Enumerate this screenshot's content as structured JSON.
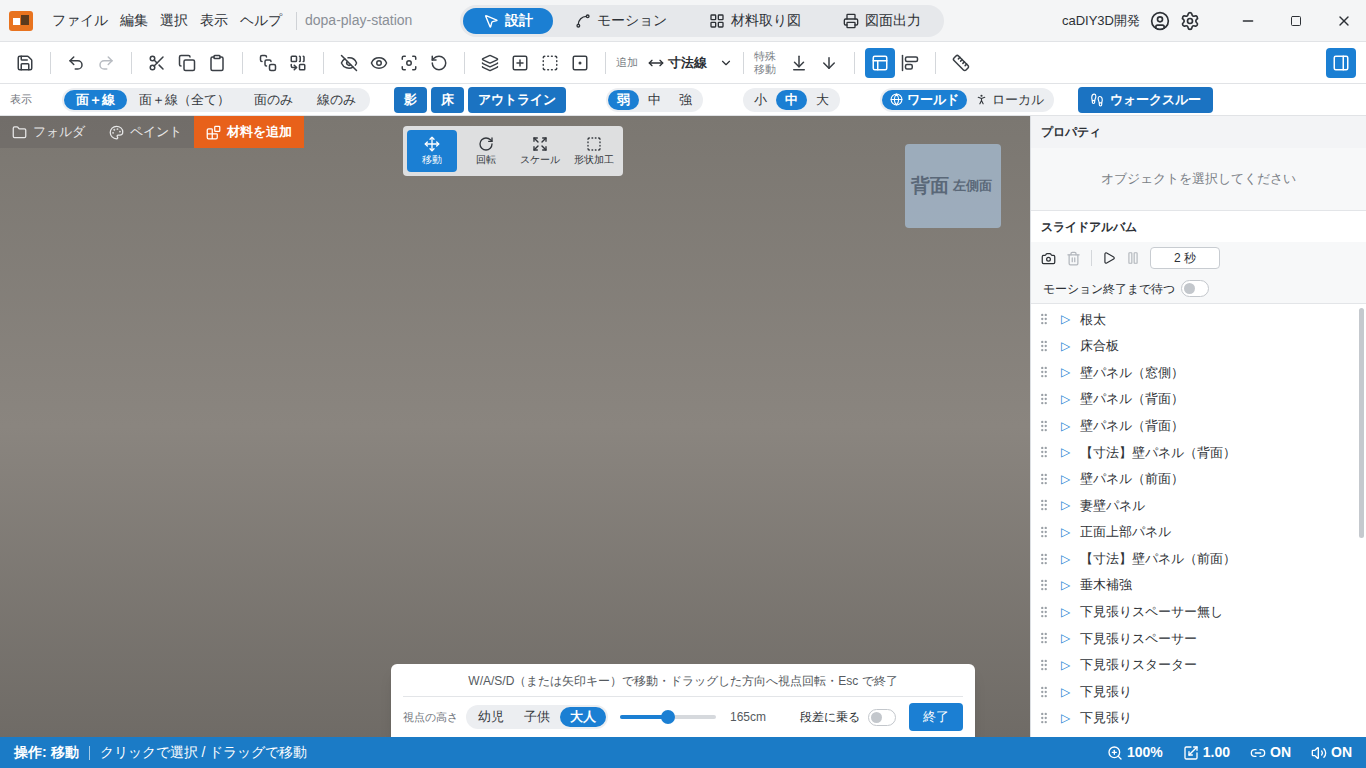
{
  "app": {
    "menu": [
      "ファイル",
      "編集",
      "選択",
      "表示",
      "ヘルプ"
    ],
    "project": "dopa-play-station",
    "modes": [
      {
        "label": "設計",
        "selected": true
      },
      {
        "label": "モーション",
        "selected": false
      },
      {
        "label": "材料取り図",
        "selected": false
      },
      {
        "label": "図面出力",
        "selected": false
      }
    ],
    "user": "caDIY3D開発"
  },
  "toolbar": {
    "redo_disabled": true,
    "add_label": "追加",
    "dimension": "寸法線",
    "special_move": [
      "特殊",
      "移動"
    ],
    "info_panel_on": true,
    "side_panel_on": true
  },
  "display_bar": {
    "label": "表示",
    "render_modes": [
      {
        "label": "面＋線",
        "selected": true
      },
      {
        "label": "面＋線（全て）",
        "selected": false
      },
      {
        "label": "面のみ",
        "selected": false
      },
      {
        "label": "線のみ",
        "selected": false
      }
    ],
    "toggles": [
      {
        "label": "影",
        "on": true
      },
      {
        "label": "床",
        "on": true
      },
      {
        "label": "アウトライン",
        "on": true
      }
    ],
    "strength": [
      {
        "label": "弱",
        "selected": true
      },
      {
        "label": "中",
        "selected": false
      },
      {
        "label": "強",
        "selected": false
      }
    ],
    "size": [
      {
        "label": "小",
        "selected": false
      },
      {
        "label": "中",
        "selected": true
      },
      {
        "label": "大",
        "selected": false
      }
    ],
    "space": [
      {
        "label": "ワールド",
        "selected": true
      },
      {
        "label": "ローカル",
        "selected": false
      }
    ],
    "walkthrough": "ウォークスルー"
  },
  "viewport": {
    "tabs": [
      "フォルダ",
      "ペイント"
    ],
    "add_material": "材料を追加",
    "tools": [
      {
        "label": "移動",
        "selected": true
      },
      {
        "label": "回転",
        "selected": false
      },
      {
        "label": "スケール",
        "selected": false
      },
      {
        "label": "形状加工",
        "selected": false
      }
    ],
    "view_cube": {
      "face": "背面",
      "side": "左側面"
    }
  },
  "walkthrough": {
    "hint": "W/A/S/D（または矢印キー）で移動・ドラッグした方向へ視点回転・Esc で終了",
    "height_label": "視点の高さ",
    "presets": [
      {
        "label": "幼児",
        "selected": false
      },
      {
        "label": "子供",
        "selected": false
      },
      {
        "label": "大人",
        "selected": true
      }
    ],
    "level": 0.5,
    "reading": "165cm",
    "step_label": "段差に乗る",
    "step_on": false,
    "exit": "終了"
  },
  "properties": {
    "title": "プロパティ",
    "placeholder": "オブジェクトを選択してください"
  },
  "slide_album": {
    "title": "スライドアルバム",
    "interval": "2 秒",
    "wait_label": "モーション終了まで待つ",
    "wait_on": false,
    "marker": "▷",
    "items": [
      "根太",
      "床合板",
      "壁パネル（窓側）",
      "壁パネル（背面）",
      "壁パネル（背面）",
      "【寸法】壁パネル（背面）",
      "壁パネル（前面）",
      "妻壁パネル",
      "正面上部パネル",
      "【寸法】壁パネル（前面）",
      "垂木補強",
      "下見張りスペーサー無し",
      "下見張りスペーサー",
      "下見張りスターター",
      "下見張り",
      "下見張り"
    ]
  },
  "status_bar": {
    "operation": "操作: 移動",
    "hint": "クリックで選択 / ドラッグで移動",
    "zoom": "100%",
    "scale": "1.00",
    "snap": "ON",
    "sound": "ON"
  }
}
